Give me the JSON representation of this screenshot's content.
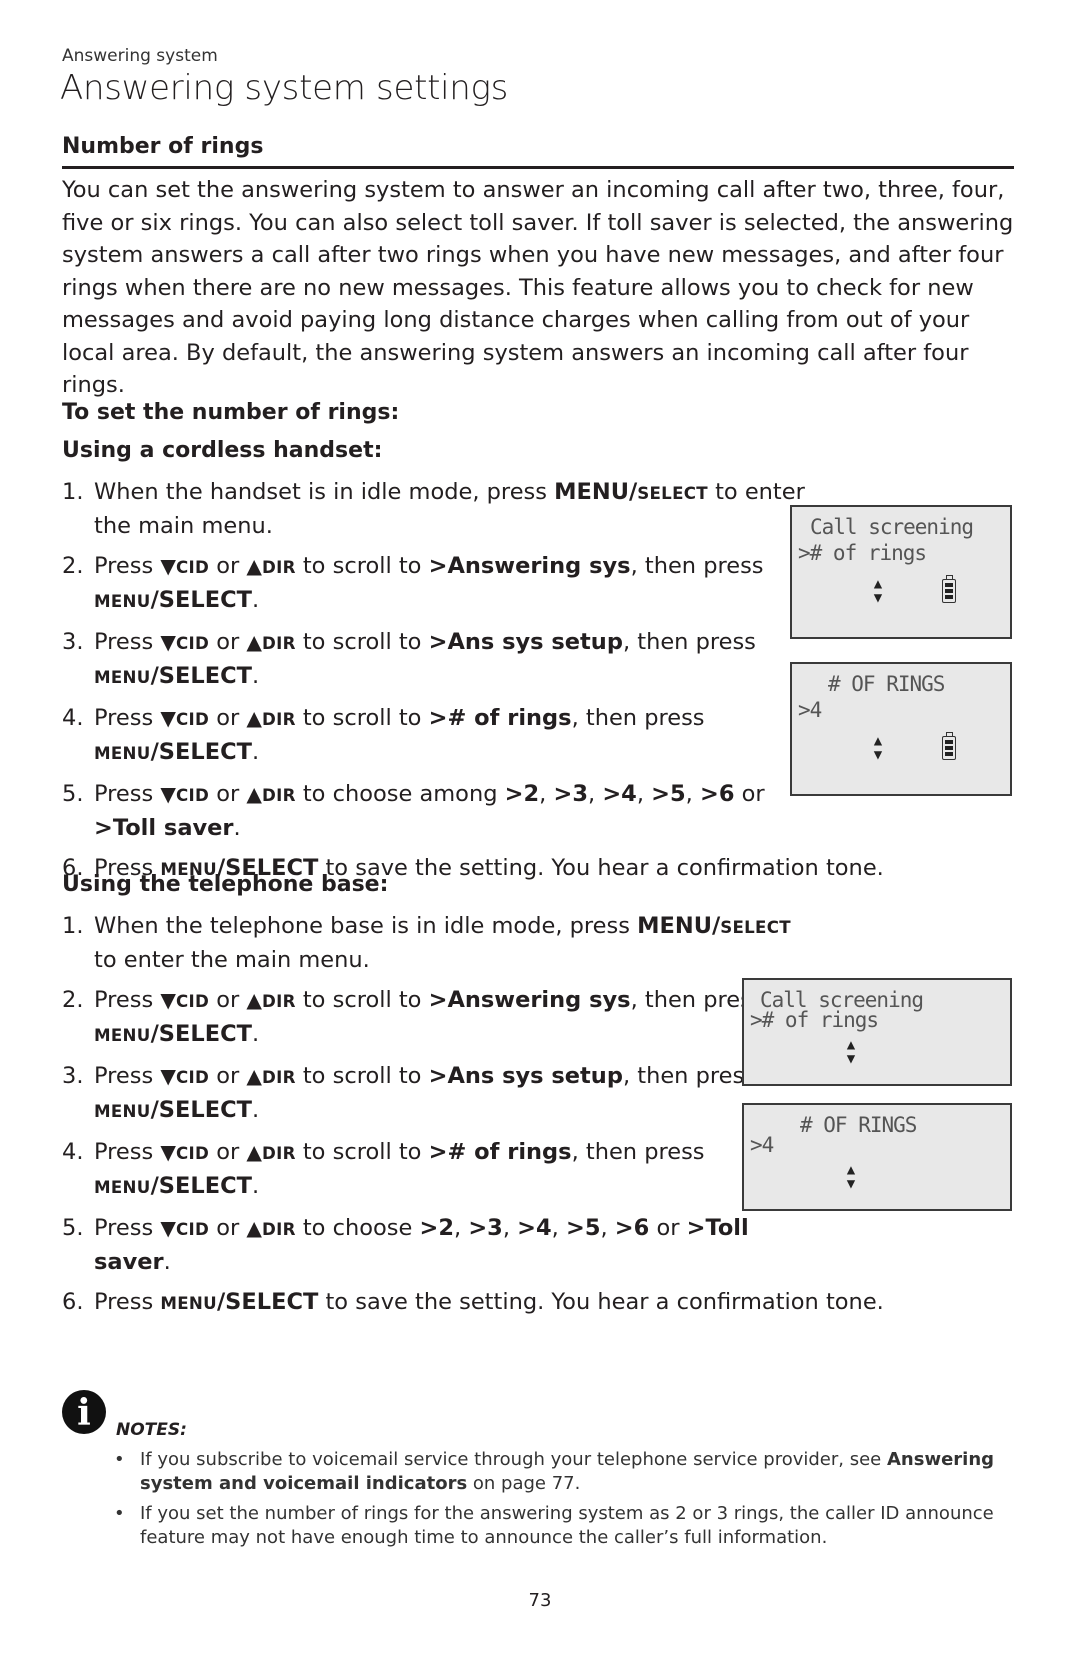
{
  "header": {
    "kicker": "Answering system",
    "title": "Answering system settings"
  },
  "section": {
    "heading": "Number of rings",
    "intro": "You can set the answering system to answer an incoming call after two, three, four, five or six rings. You can also select toll saver. If toll saver is selected, the answering system answers a call after two rings when you have new messages, and after four rings when there are no new messages. This feature allows you to check for new messages and avoid paying long distance charges when calling from out of your local area. By default, the answering system answers an incoming call after four rings."
  },
  "procedure": {
    "heading": "To set the number of rings:",
    "handset": {
      "heading": "Using a cordless handset:",
      "steps": [
        {
          "n": "1.",
          "html": "When the handset is in idle mode, press <b>MENU/</b><span class=\"sc\">SELECT</span> to enter the main menu."
        },
        {
          "n": "2.",
          "html": "Press <b><span class=\"tri\">▼</span><span class=\"sc\">CID</span></b> or <b><span class=\"tri\">▲</span><span class=\"sc\">DIR</span></b> to scroll to <b>&gt;Answering sys</b>, then press <span class=\"sc\">MENU</span><b>/SELECT</b>."
        },
        {
          "n": "3.",
          "html": "Press <b><span class=\"tri\">▼</span><span class=\"sc\">CID</span></b> or <b><span class=\"tri\">▲</span><span class=\"sc\">DIR</span></b> to scroll to <b>&gt;Ans sys setup</b>, then press <span class=\"sc\">MENU</span><b>/SELECT</b>."
        },
        {
          "n": "4.",
          "html": "Press <b><span class=\"tri\">▼</span><span class=\"sc\">CID</span></b> or <b><span class=\"tri\">▲</span><span class=\"sc\">DIR</span></b> to scroll to <b>&gt;# of rings</b>, then press <span class=\"sc\">MENU</span><b>/SELECT</b>."
        },
        {
          "n": "5.",
          "html": "Press <b><span class=\"tri\">▼</span><span class=\"sc\">CID</span></b> or <b><span class=\"tri\">▲</span><span class=\"sc\">DIR</span></b> to choose among <b>&gt;2</b>, <b>&gt;3</b>, <b>&gt;4</b>, <b>&gt;5</b>, <b>&gt;6</b> or <b>&gt;Toll saver</b>."
        },
        {
          "n": "6.",
          "html": "Press <span class=\"sc\">MENU</span><b>/SELECT</b> to save the setting. You hear a confirmation tone."
        }
      ],
      "screens": [
        {
          "line1": "Call screening",
          "line2": ">#  of rings"
        },
        {
          "line1": "#  OF RINGS",
          "line2": ">4"
        }
      ]
    },
    "base": {
      "heading": "Using the telephone base:",
      "steps": [
        {
          "n": "1.",
          "html": "When the telephone base is in idle mode, press <b>MENU/</b><span class=\"sc\">SELECT</span> to enter the main menu."
        },
        {
          "n": "2.",
          "html": "Press <b><span class=\"tri\">▼</span><span class=\"sc\">CID</span></b> or <b><span class=\"tri\">▲</span><span class=\"sc\">DIR</span></b> to scroll to <b>&gt;Answering sys</b>, then press <span class=\"sc\">MENU</span><b>/SELECT</b>."
        },
        {
          "n": "3.",
          "html": "Press <b><span class=\"tri\">▼</span><span class=\"sc\">CID</span></b> or <b><span class=\"tri\">▲</span><span class=\"sc\">DIR</span></b> to scroll to <b>&gt;Ans sys setup</b>, then press <span class=\"sc\">MENU</span><b>/SELECT</b>."
        },
        {
          "n": "4.",
          "html": "Press <b><span class=\"tri\">▼</span><span class=\"sc\">CID</span></b> or <b><span class=\"tri\">▲</span><span class=\"sc\">DIR</span></b> to scroll to <b>&gt;# of rings</b>, then press <span class=\"sc\">MENU</span><b>/SELECT</b>."
        },
        {
          "n": "5.",
          "html": "Press <b><span class=\"tri\">▼</span><span class=\"sc\">CID</span></b> or <b><span class=\"tri\">▲</span><span class=\"sc\">DIR</span></b> to choose <b>&gt;2</b>, <b>&gt;3</b>, <b>&gt;4</b>, <b>&gt;5</b>, <b>&gt;6</b> or <b>&gt;Toll saver</b>."
        },
        {
          "n": "6.",
          "html": "Press <span class=\"sc\">MENU</span><b>/SELECT</b> to save the setting. You hear a confirmation tone."
        }
      ],
      "screens": [
        {
          "line1": "Call screening",
          "line2": ">#  of rings"
        },
        {
          "line1": "#  OF RINGS",
          "line2": ">4"
        }
      ]
    }
  },
  "notes": {
    "label": "NOTES:",
    "icon": "info-icon",
    "items": [
      {
        "html": "If you subscribe to voicemail service through your telephone service provider, see <b>Answering system and voicemail indicators</b> on page 77."
      },
      {
        "html": "If you set the number of rings for the answering system as 2 or 3 rings, the caller ID announce feature may not have enough time to announce the caller’s full information."
      }
    ]
  },
  "footer": {
    "page_number": "73"
  }
}
